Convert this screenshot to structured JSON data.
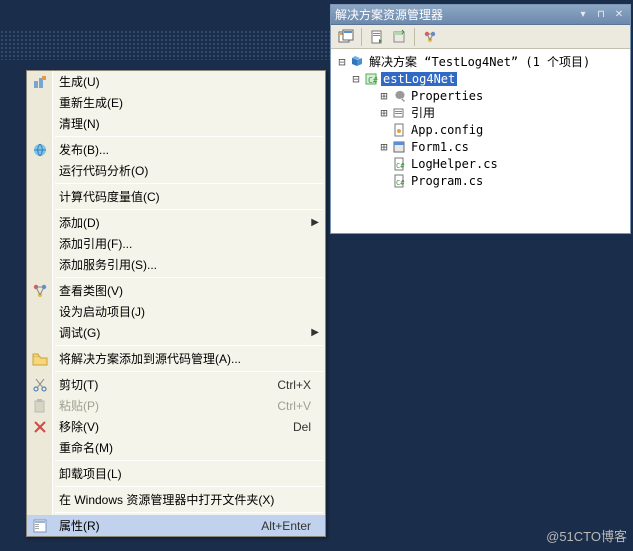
{
  "context_menu": {
    "build": "生成(U)",
    "rebuild": "重新生成(E)",
    "clean": "清理(N)",
    "publish": "发布(B)...",
    "code_analysis": "运行代码分析(O)",
    "calc_metrics": "计算代码度量值(C)",
    "add": "添加(D)",
    "add_ref": "添加引用(F)...",
    "add_svc_ref": "添加服务引用(S)...",
    "class_diag": "查看类图(V)",
    "set_startup": "设为启动项目(J)",
    "debug": "调试(G)",
    "add_to_scm": "将解决方案添加到源代码管理(A)...",
    "cut": "剪切(T)",
    "cut_sc": "Ctrl+X",
    "paste": "粘贴(P)",
    "paste_sc": "Ctrl+V",
    "remove": "移除(V)",
    "remove_sc": "Del",
    "rename": "重命名(M)",
    "unload": "卸载项目(L)",
    "open_explorer": "在 Windows 资源管理器中打开文件夹(X)",
    "properties": "属性(R)",
    "properties_sc": "Alt+Enter"
  },
  "se": {
    "panel_title": "解决方案资源管理器",
    "solution_label": "解决方案 “TestLog4Net” (1 个项目)",
    "project": "estLog4Net",
    "children": {
      "props": "Properties",
      "refs": "引用",
      "appcfg": "App.config",
      "form1": "Form1.cs",
      "loghelper": "LogHelper.cs",
      "program": "Program.cs"
    }
  },
  "watermark": "@51CTO博客"
}
